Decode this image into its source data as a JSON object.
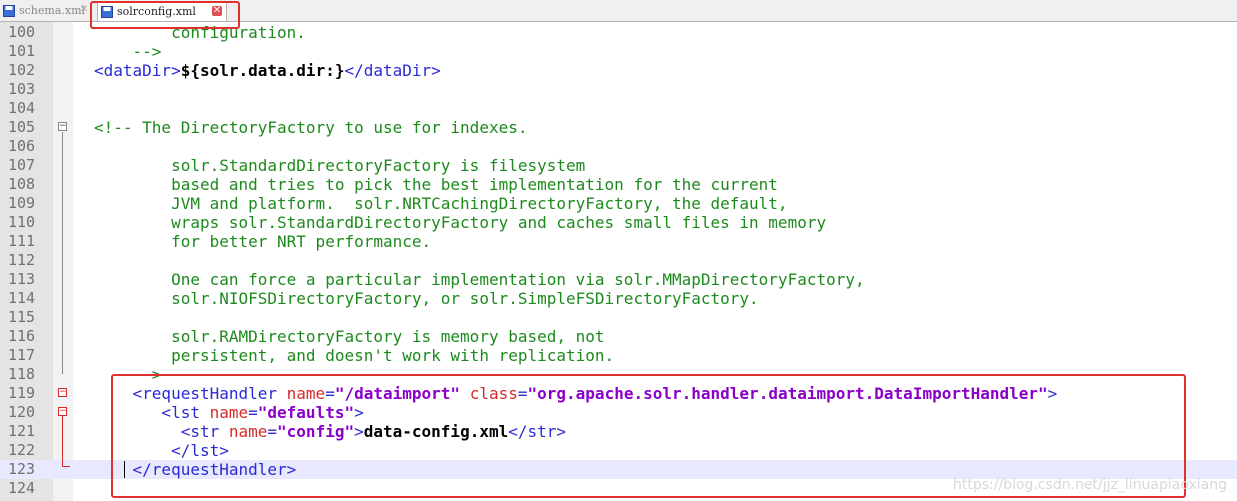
{
  "tabs": [
    {
      "label": "schema.xml",
      "active": false,
      "close": "✕"
    },
    {
      "label": "solrconfig.xml",
      "active": true,
      "close": "✕"
    }
  ],
  "colors": {
    "comment": "#1d8a1d",
    "tag": "#2a2ad6",
    "attr": "#d62a2a",
    "value": "#8a00c8",
    "highlight": "#e0312d"
  },
  "editor": {
    "lines": [
      {
        "n": "100",
        "parts": [
          {
            "t": "        configuration.",
            "c": "cm"
          }
        ]
      },
      {
        "n": "101",
        "parts": [
          {
            "t": "    -->",
            "c": "cm"
          }
        ]
      },
      {
        "n": "102",
        "parts": [
          {
            "t": "<dataDir>",
            "c": "tg"
          },
          {
            "t": "${solr.data.dir:}",
            "c": "tx"
          },
          {
            "t": "</dataDir>",
            "c": "tg"
          }
        ]
      },
      {
        "n": "103",
        "parts": []
      },
      {
        "n": "104",
        "parts": []
      },
      {
        "n": "105",
        "parts": [
          {
            "t": "<!-- The DirectoryFactory to use for indexes.",
            "c": "cm"
          }
        ]
      },
      {
        "n": "106",
        "parts": []
      },
      {
        "n": "107",
        "parts": [
          {
            "t": "        solr.StandardDirectoryFactory is filesystem",
            "c": "cm"
          }
        ]
      },
      {
        "n": "108",
        "parts": [
          {
            "t": "        based and tries to pick the best implementation for the current",
            "c": "cm"
          }
        ]
      },
      {
        "n": "109",
        "parts": [
          {
            "t": "        JVM and platform.  solr.NRTCachingDirectoryFactory, the default,",
            "c": "cm"
          }
        ]
      },
      {
        "n": "110",
        "parts": [
          {
            "t": "        wraps solr.StandardDirectoryFactory and caches small files in memory",
            "c": "cm"
          }
        ]
      },
      {
        "n": "111",
        "parts": [
          {
            "t": "        for better NRT performance.",
            "c": "cm"
          }
        ]
      },
      {
        "n": "112",
        "parts": []
      },
      {
        "n": "113",
        "parts": [
          {
            "t": "        One can force a particular implementation via solr.MMapDirectoryFactory,",
            "c": "cm"
          }
        ]
      },
      {
        "n": "114",
        "parts": [
          {
            "t": "        solr.NIOFSDirectoryFactory, or solr.SimpleFSDirectoryFactory.",
            "c": "cm"
          }
        ]
      },
      {
        "n": "115",
        "parts": []
      },
      {
        "n": "116",
        "parts": [
          {
            "t": "        solr.RAMDirectoryFactory is memory based, not",
            "c": "cm"
          }
        ]
      },
      {
        "n": "117",
        "parts": [
          {
            "t": "        persistent, and doesn't work with replication.",
            "c": "cm"
          }
        ]
      },
      {
        "n": "118",
        "parts": [
          {
            "t": "    -->",
            "c": "cm"
          }
        ]
      },
      {
        "n": "119",
        "parts": [
          {
            "t": "    <requestHandler ",
            "c": "tg"
          },
          {
            "t": "name",
            "c": "at"
          },
          {
            "t": "=",
            "c": "tg"
          },
          {
            "t": "\"/dataimport\"",
            "c": "av"
          },
          {
            "t": " class",
            "c": "at"
          },
          {
            "t": "=",
            "c": "tg"
          },
          {
            "t": "\"org.apache.solr.handler.dataimport.DataImportHandler\"",
            "c": "av"
          },
          {
            "t": ">",
            "c": "tg"
          }
        ]
      },
      {
        "n": "120",
        "parts": [
          {
            "t": "       <lst ",
            "c": "tg"
          },
          {
            "t": "name",
            "c": "at"
          },
          {
            "t": "=",
            "c": "tg"
          },
          {
            "t": "\"defaults\"",
            "c": "av"
          },
          {
            "t": ">",
            "c": "tg"
          }
        ]
      },
      {
        "n": "121",
        "parts": [
          {
            "t": "         <str ",
            "c": "tg"
          },
          {
            "t": "name",
            "c": "at"
          },
          {
            "t": "=",
            "c": "tg"
          },
          {
            "t": "\"config\"",
            "c": "av"
          },
          {
            "t": ">",
            "c": "tg"
          },
          {
            "t": "data-config.xml",
            "c": "tx"
          },
          {
            "t": "</str>",
            "c": "tg"
          }
        ]
      },
      {
        "n": "122",
        "parts": [
          {
            "t": "        </lst>",
            "c": "tg"
          }
        ]
      },
      {
        "n": "123",
        "parts": [
          {
            "t": "    </requestHandler>",
            "c": "tg"
          }
        ]
      },
      {
        "n": "124",
        "parts": []
      }
    ]
  },
  "watermark": "https://blog.csdn.net/jjz_linuapiaoxiang"
}
